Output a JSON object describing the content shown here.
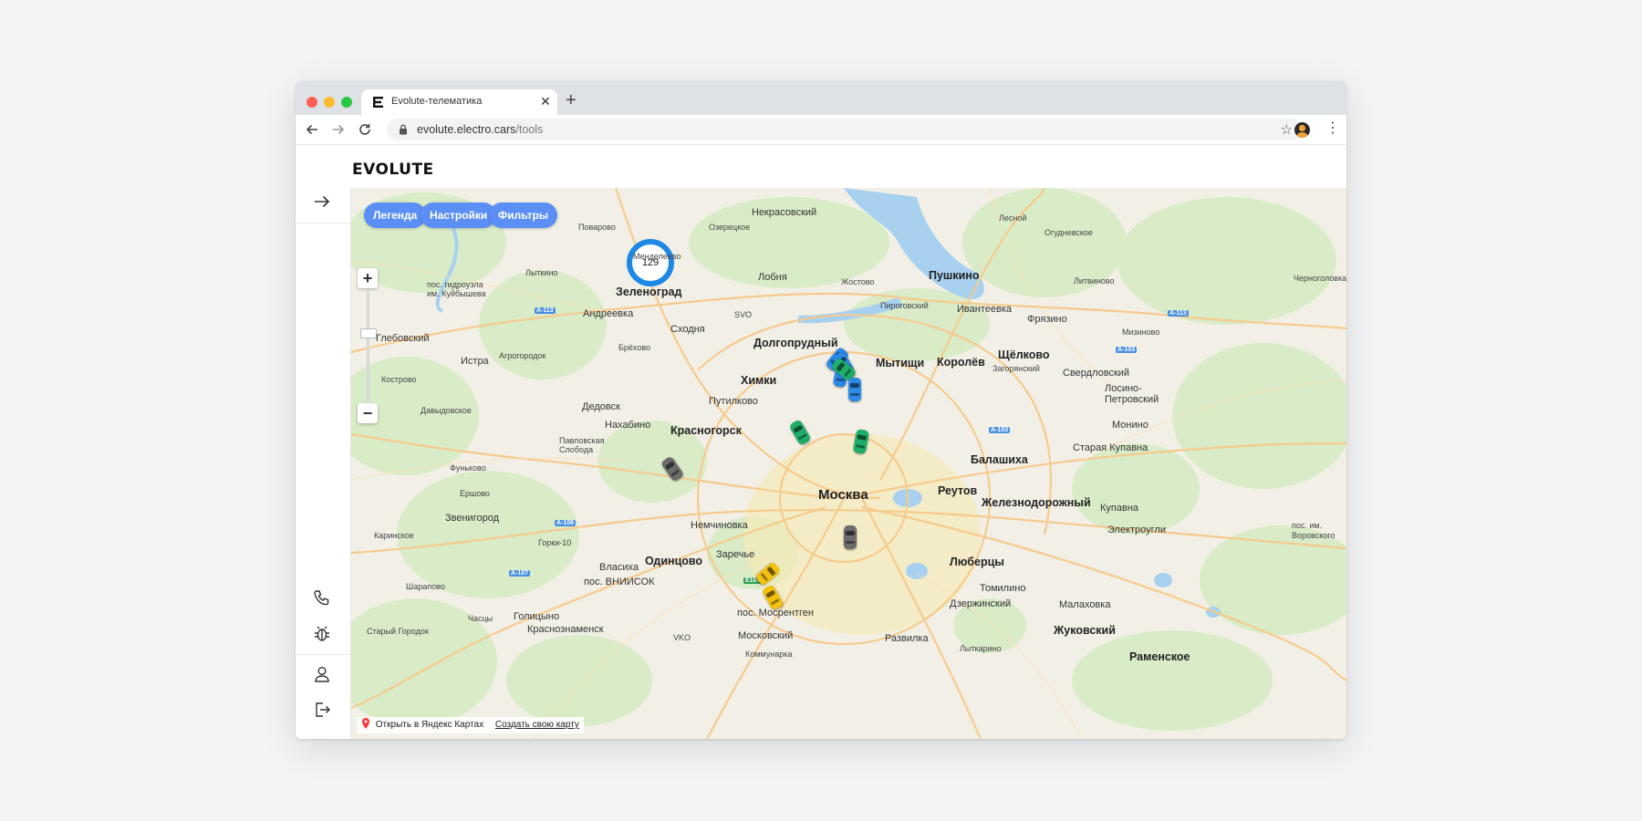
{
  "browser": {
    "tab_title": "Evolute-телематика",
    "url_host": "evolute.electro.cars",
    "url_path": "/tools"
  },
  "app": {
    "brand": "EVOLUTE"
  },
  "map": {
    "buttons": [
      "Легенда",
      "Настройки",
      "Фильтры"
    ],
    "cluster_count": "129",
    "attribution": {
      "open_label": "Открыть в Яндекс Картах",
      "create_label": "Создать свою карту"
    },
    "cities_major": [
      "Москва"
    ],
    "cities": [
      "Зеленоград",
      "Долгопрудный",
      "Химки",
      "Мытищи",
      "Королёв",
      "Пушкино",
      "Щёлково",
      "Красногорск",
      "Балашиха",
      "Одинцово",
      "Люберцы",
      "Реутов",
      "Железнодорожный",
      "Жуковский",
      "Раменское"
    ],
    "places": [
      "Некрасовский",
      "Лесной",
      "Поварово",
      "Озерецкое",
      "Менделеево",
      "Огудневское",
      "Черноголовка",
      "Лыткино",
      "Лобня",
      "Жостово",
      "Литвиново",
      "пос. гидроузла им. Куйбышева",
      "Андреевка",
      "SVO",
      "Пироговский",
      "Ивантеевка",
      "Фрязино",
      "Сходня",
      "Мизиново",
      "Глебовский",
      "Брёхово",
      "Загорянский",
      "Свердловский",
      "Истра",
      "Агрогородок",
      "Путилково",
      "Лосино-Петровский",
      "Кострово",
      "Давыдовское",
      "Дедовск",
      "Нахабино",
      "Монино",
      "Павловская Слобода",
      "Старая Купавна",
      "Фуньково",
      "Ершово",
      "Звенигород",
      "Немчиновка",
      "Купавна",
      "Каринское",
      "Горки-10",
      "Электроугли",
      "Заречье",
      "Власиха",
      "пос. ВНИИСОК",
      "Томилино",
      "Шарапово",
      "Часцы",
      "Голицыно",
      "Малаховка",
      "Дзержинский",
      "пос. Мосрентген",
      "Краснознаменск",
      "Старый Городок",
      "VKO",
      "Московский",
      "Развилка",
      "Лыткарино",
      "Коммунарка",
      "пос. им. Воровского"
    ],
    "road_badges": [
      "A-113",
      "A-113",
      "A-103",
      "A-103",
      "A-106",
      "A-107",
      "E105"
    ],
    "car_colors": {
      "blue": "#2b8ae6",
      "green": "#1fae6a",
      "gray": "#6b6b6b",
      "yellow": "#f4c20d"
    }
  }
}
